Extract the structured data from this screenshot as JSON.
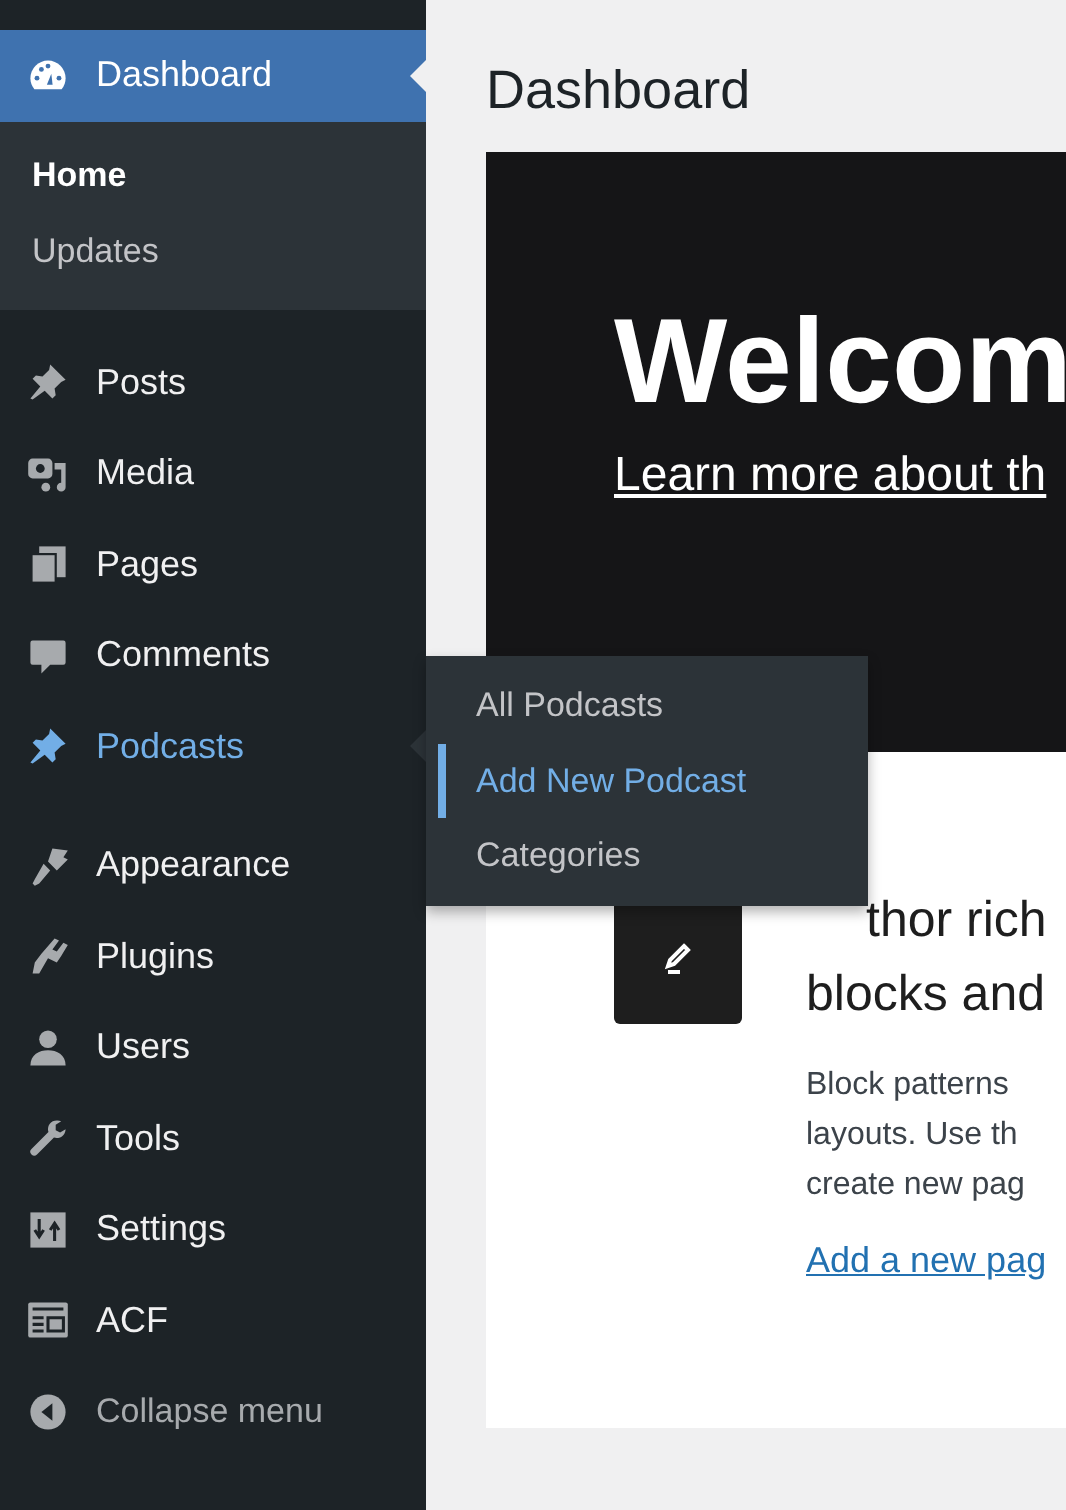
{
  "sidebar": {
    "items": [
      {
        "label": "Dashboard",
        "kind": "dashboard",
        "selected": true,
        "highlighted": false,
        "children": [
          {
            "label": "Home",
            "selected": true
          },
          {
            "label": "Updates",
            "selected": false
          }
        ]
      },
      {
        "label": "Posts",
        "kind": "pin",
        "selected": false,
        "highlighted": false
      },
      {
        "label": "Media",
        "kind": "media",
        "selected": false,
        "highlighted": false
      },
      {
        "label": "Pages",
        "kind": "pages",
        "selected": false,
        "highlighted": false
      },
      {
        "label": "Comments",
        "kind": "comment",
        "selected": false,
        "highlighted": false
      },
      {
        "label": "Podcasts",
        "kind": "pin",
        "selected": false,
        "highlighted": true,
        "flyout": [
          {
            "label": "All Podcasts",
            "selected": false
          },
          {
            "label": "Add New Podcast",
            "selected": true
          },
          {
            "label": "Categories",
            "selected": false
          }
        ]
      },
      {
        "label": "Appearance",
        "kind": "brush",
        "selected": false,
        "highlighted": false,
        "separator_before": true
      },
      {
        "label": "Plugins",
        "kind": "plug",
        "selected": false,
        "highlighted": false
      },
      {
        "label": "Users",
        "kind": "user",
        "selected": false,
        "highlighted": false
      },
      {
        "label": "Tools",
        "kind": "wrench",
        "selected": false,
        "highlighted": false
      },
      {
        "label": "Settings",
        "kind": "settings",
        "selected": false,
        "highlighted": false
      },
      {
        "label": "ACF",
        "kind": "table",
        "selected": false,
        "highlighted": false
      }
    ],
    "collapse": {
      "label": "Collapse menu"
    }
  },
  "page": {
    "title": "Dashboard",
    "welcome": {
      "heading": "Welcom",
      "link": "Learn more about th"
    },
    "card": {
      "heading_lines": [
        "thor rich",
        "blocks and"
      ],
      "text_lines": [
        "Block patterns",
        "layouts. Use th",
        "create new pag"
      ],
      "link": "Add a new pag"
    }
  }
}
